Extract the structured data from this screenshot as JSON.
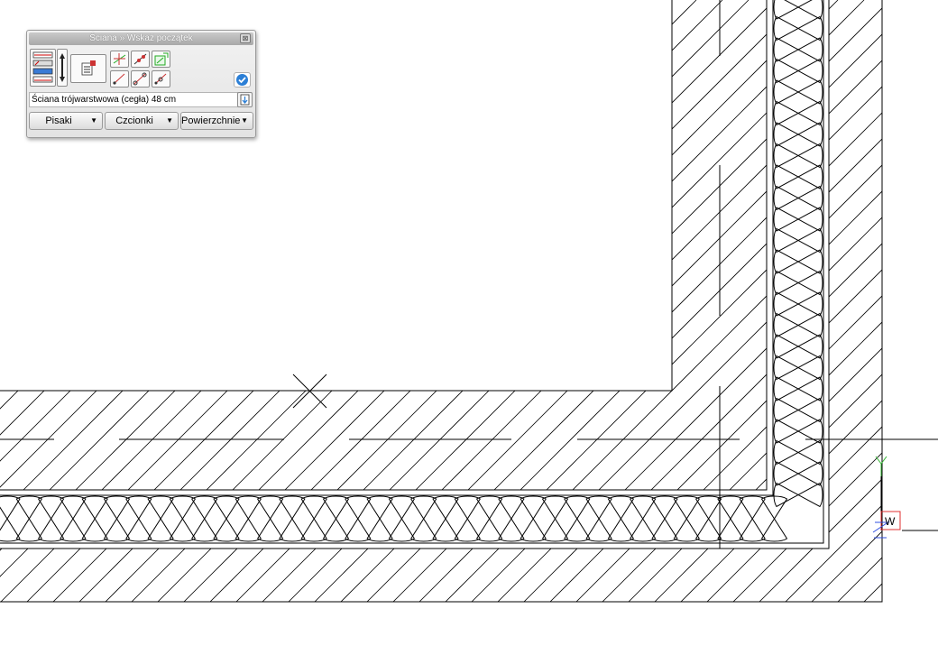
{
  "panel": {
    "title": "Ściana » Wskaż początek",
    "close_glyph": "⊠",
    "status_text": "Ściana trójwarstwowa (cegła) 48 cm",
    "dropdowns": [
      {
        "label": "Pisaki"
      },
      {
        "label": "Czcionki"
      },
      {
        "label": "Powierzchnie"
      }
    ],
    "tools": [
      {
        "icon": "wall-layers-icon"
      },
      {
        "icon": "flip-arrows-icon"
      },
      {
        "icon": "wall-properties-icon"
      },
      {
        "icon": "snap-point-icon"
      },
      {
        "icon": "snap-line-icon"
      },
      {
        "icon": "snap-grid-icon"
      },
      {
        "icon": "snap-start-icon"
      },
      {
        "icon": "snap-end-icon"
      },
      {
        "icon": "snap-middle-icon"
      }
    ],
    "confirm_icon": "checkmark-icon",
    "status_icon": "wall-pick-icon"
  },
  "ucs": {
    "y_label": "Y",
    "w_label": "W",
    "colors": {
      "y_axis": "#38b838",
      "x_box": "#e03030",
      "z_axis": "#3050e0"
    }
  },
  "colors": {
    "drawing_lines": "#000000",
    "background": "#ffffff"
  }
}
